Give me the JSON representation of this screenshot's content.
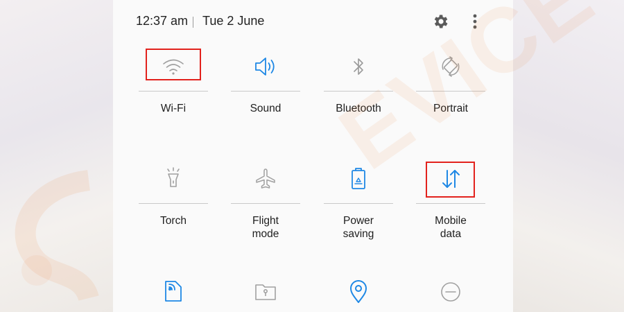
{
  "status": {
    "time": "12:37 am",
    "date": "Tue 2 June",
    "settings_icon": "gear-icon",
    "more_icon": "more-vert-icon"
  },
  "tiles": [
    {
      "label": "Wi-Fi",
      "icon": "wifi-icon",
      "active": false
    },
    {
      "label": "Sound",
      "icon": "speaker-icon",
      "active": true
    },
    {
      "label": "Bluetooth",
      "icon": "bluetooth-icon",
      "active": false
    },
    {
      "label": "Portrait",
      "icon": "rotate-icon",
      "active": false
    },
    {
      "label": "Torch",
      "icon": "flashlight-icon",
      "active": false
    },
    {
      "label": "Flight\nmode",
      "icon": "airplane-icon",
      "active": false
    },
    {
      "label": "Power\nsaving",
      "icon": "battery-recycle-icon",
      "active": true
    },
    {
      "label": "Mobile\ndata",
      "icon": "up-down-arrows-icon",
      "active": true
    },
    {
      "icon": "nfc-icon",
      "active": true
    },
    {
      "icon": "secure-folder-icon",
      "active": false
    },
    {
      "icon": "location-icon",
      "active": true
    },
    {
      "icon": "do-not-disturb-icon",
      "active": false
    }
  ],
  "highlighted": [
    "Wi-Fi",
    "Mobile data"
  ],
  "colors": {
    "active": "#1e88e5",
    "inactive": "#9a9a9a",
    "highlight": "#e2211c"
  },
  "watermark": "EVICETRICKS"
}
